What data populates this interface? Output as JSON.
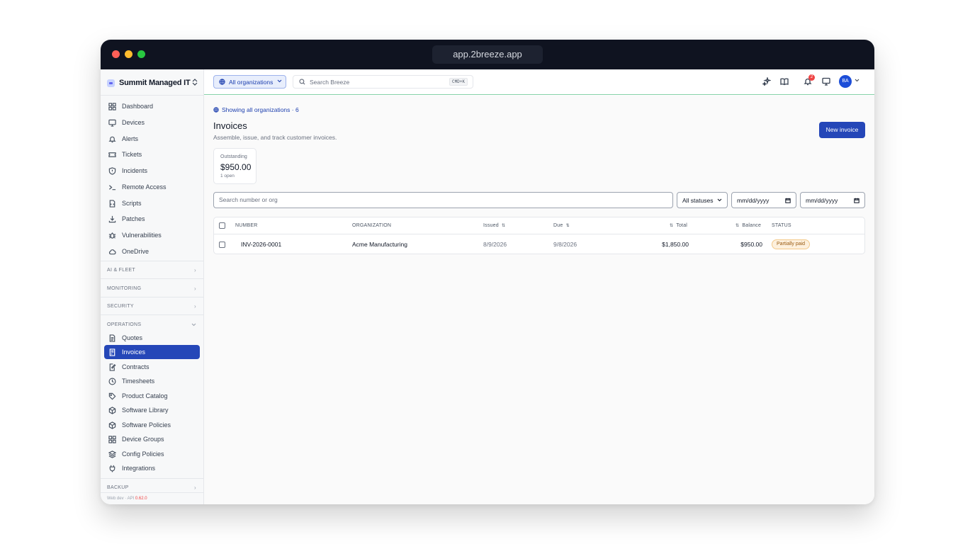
{
  "browser": {
    "url": "app.2breeze.app"
  },
  "sidebar": {
    "brand": "Summit Managed IT",
    "items": [
      {
        "label": "Dashboard",
        "icon": "grid-icon"
      },
      {
        "label": "Devices",
        "icon": "monitor-icon"
      },
      {
        "label": "Alerts",
        "icon": "bell-icon"
      },
      {
        "label": "Tickets",
        "icon": "ticket-icon"
      },
      {
        "label": "Incidents",
        "icon": "shield-icon"
      },
      {
        "label": "Remote Access",
        "icon": "terminal-icon"
      },
      {
        "label": "Scripts",
        "icon": "file-code-icon"
      },
      {
        "label": "Patches",
        "icon": "download-icon"
      },
      {
        "label": "Vulnerabilities",
        "icon": "bug-icon"
      },
      {
        "label": "OneDrive",
        "icon": "cloud-icon"
      }
    ],
    "sections": {
      "ai_fleet": "AI & FLEET",
      "monitoring": "MONITORING",
      "security": "SECURITY",
      "operations": "OPERATIONS",
      "backup": "BACKUP"
    },
    "operations_items": [
      {
        "label": "Quotes",
        "icon": "document-icon"
      },
      {
        "label": "Invoices",
        "icon": "invoice-icon"
      },
      {
        "label": "Contracts",
        "icon": "file-pen-icon"
      },
      {
        "label": "Timesheets",
        "icon": "clock-icon"
      },
      {
        "label": "Product Catalog",
        "icon": "tag-icon"
      },
      {
        "label": "Software Library",
        "icon": "package-icon"
      },
      {
        "label": "Software Policies",
        "icon": "package-icon"
      },
      {
        "label": "Device Groups",
        "icon": "grid-icon"
      },
      {
        "label": "Config Policies",
        "icon": "layers-icon"
      },
      {
        "label": "Integrations",
        "icon": "plug-icon"
      }
    ],
    "version_prefix": "Web dev · API ",
    "version_value": "0.62.0"
  },
  "topbar": {
    "org_selector": "All organizations",
    "search_placeholder": "Search Breeze",
    "search_shortcut": "CMD+K",
    "notification_count": "2",
    "avatar_initials": "BA"
  },
  "page": {
    "scope_text": "Showing all organizations · 6",
    "title": "Invoices",
    "subtitle": "Assemble, issue, and track customer invoices.",
    "new_button": "New invoice",
    "stat": {
      "label": "Outstanding",
      "value": "$950.00",
      "sub": "1 open"
    },
    "filters": {
      "search_placeholder": "Search number or org",
      "status_value": "All statuses",
      "date_from_placeholder": "mm/dd/yyyy",
      "date_to_placeholder": "mm/dd/yyyy"
    },
    "table": {
      "headers": {
        "number": "NUMBER",
        "organization": "ORGANIZATION",
        "issued": "Issued",
        "due": "Due",
        "total": "Total",
        "balance": "Balance",
        "status": "STATUS"
      },
      "rows": [
        {
          "number": "INV-2026-0001",
          "organization": "Acme Manufacturing",
          "issued": "8/9/2026",
          "due": "9/8/2026",
          "total": "$1,850.00",
          "balance": "$950.00",
          "status": "Partially paid"
        }
      ]
    }
  },
  "colors": {
    "accent": "#2547b8",
    "titlebar": "#0f1320",
    "status_partial_bg": "#fdf0dd",
    "status_partial_text": "#9a5a10",
    "badge": "#ef4444"
  }
}
